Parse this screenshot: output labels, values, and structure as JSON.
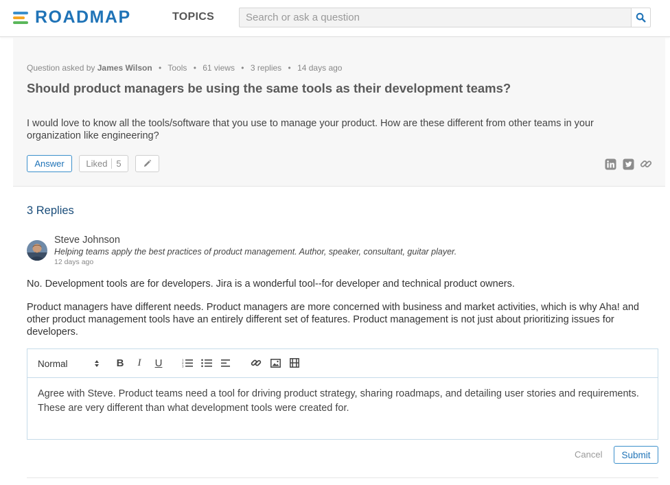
{
  "header": {
    "logo_text": "ROADMAP",
    "nav_topics": "TOPICS",
    "search_placeholder": "Search or ask a question"
  },
  "question": {
    "meta_prefix": "Question asked by",
    "author": "James Wilson",
    "topic": "Tools",
    "views": "61 views",
    "replies": "3 replies",
    "age": "14 days ago",
    "title": "Should product managers be using the same tools as their development teams?",
    "body": "I would love to know all the tools/software that you use to manage your product. How are these different from other teams in your organization like engineering?",
    "answer_label": "Answer",
    "liked_label": "Liked",
    "liked_count": "5"
  },
  "replies": {
    "heading": "3 Replies",
    "items": [
      {
        "author": "Steve Johnson",
        "tagline": "Helping teams apply the best practices of product management. Author, speaker, consultant, guitar player.",
        "age": "12 days ago",
        "paragraphs": [
          "No. Development tools are for developers. Jira is a wonderful tool--for developer and technical product owners.",
          "Product managers have different needs. Product managers are more concerned with business and market activities, which is why Aha! and other product management tools have an entirely different set of features. Product management is not just about prioritizing issues for developers."
        ]
      }
    ]
  },
  "editor": {
    "format_value": "Normal",
    "text": "Agree with Steve. Product teams need a tool for driving product strategy, sharing roadmaps, and detailing user stories and requirements. These are very different than what development tools were created for.",
    "cancel_label": "Cancel",
    "submit_label": "Submit"
  },
  "icons": {
    "search": "search-icon",
    "edit": "pencil-icon",
    "linkedin": "linkedin-icon",
    "twitter": "twitter-icon",
    "link": "link-icon"
  },
  "colors": {
    "brand_blue": "#1f73b7",
    "logo_orange": "#f5a623",
    "logo_green": "#5bb75b",
    "logo_blue": "#3b8fcb"
  }
}
